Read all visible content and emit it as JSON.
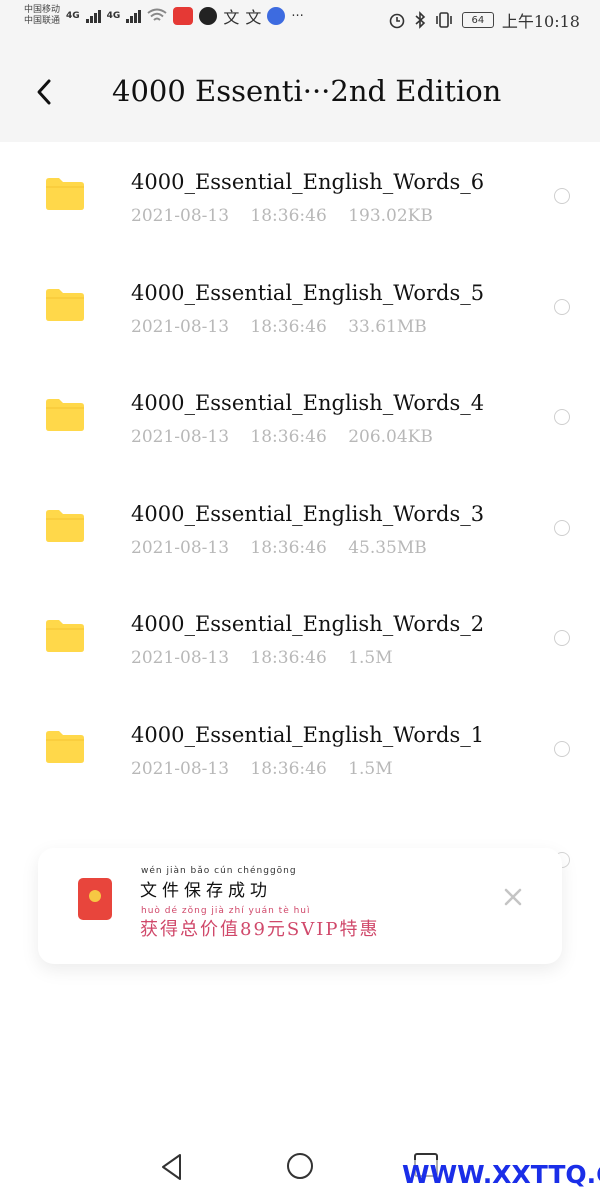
{
  "status_bar": {
    "carrier1": "中国移动",
    "carrier2": "中国联通",
    "network1": "4G",
    "network2": "4G",
    "app_icon_text_1": "文",
    "app_icon_text_2": "文",
    "more": "···",
    "battery": "64",
    "time": "上午10:18"
  },
  "header": {
    "back_icon": "chevron-left-icon",
    "title": "4000 Essenti···2nd Edition"
  },
  "files": [
    {
      "name": "4000_Essential_English_Words_6",
      "date": "2021-08-13",
      "time": "18:36:46",
      "size": "193.02KB"
    },
    {
      "name": "4000_Essential_English_Words_5",
      "date": "2021-08-13",
      "time": "18:36:46",
      "size": "33.61MB"
    },
    {
      "name": "4000_Essential_English_Words_4",
      "date": "2021-08-13",
      "time": "18:36:46",
      "size": "206.04KB"
    },
    {
      "name": "4000_Essential_English_Words_3",
      "date": "2021-08-13",
      "time": "18:36:46",
      "size": "45.35MB"
    },
    {
      "name": "4000_Essential_English_Words_2",
      "date": "2021-08-13",
      "time": "18:36:46",
      "size": "1.5M"
    },
    {
      "name": "4000_Essential_English_Words_1",
      "date": "2021-08-13",
      "time": "18:36:46",
      "size": "1.5M"
    }
  ],
  "toast": {
    "pinyin1": "wén jiàn bǎo cún chénggōng",
    "line1": "文件保存成功",
    "pinyin2": "huò dé zǒng jià zhí yuán tè huì",
    "line2": "获得总价值89元SVIP特惠",
    "icon": "red-envelope-icon"
  },
  "watermark": "WWW.XXTTQ.COM",
  "colors": {
    "folder": "#FFD84A",
    "accent_pink": "#D0486A",
    "meta_gray": "#B8B8B8",
    "watermark_blue": "#1A2EE8"
  }
}
